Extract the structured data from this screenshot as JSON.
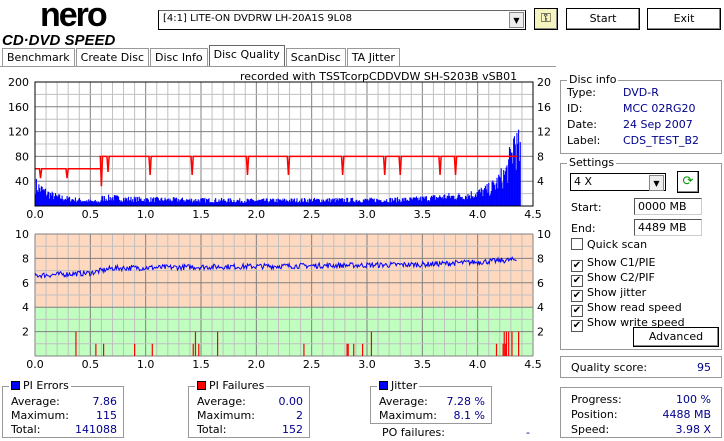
{
  "app": {
    "logo_top": "nero",
    "logo_bottom": "CD·DVD SPEED"
  },
  "toolbar": {
    "drive": "[4:1]  LITE-ON DVDRW LH-20A1S 9L08",
    "start": "Start",
    "exit": "Exit",
    "settings_icon": "keys-icon"
  },
  "tabs": [
    {
      "label": "Benchmark"
    },
    {
      "label": "Create Disc"
    },
    {
      "label": "Disc Info"
    },
    {
      "label": "Disc Quality",
      "active": true
    },
    {
      "label": "ScanDisc"
    },
    {
      "label": "TA Jitter"
    }
  ],
  "recorded_with": "recorded with TSSTcorpCDDVDW SH-S203B  vSB01",
  "disc_info": {
    "title": "Disc info",
    "type_label": "Type:",
    "type": "DVD-R",
    "id_label": "ID:",
    "id": "MCC 02RG20",
    "date_label": "Date:",
    "date": "24 Sep 2007",
    "label_label": "Label:",
    "label": "CDS_TEST_B2"
  },
  "settings": {
    "title": "Settings",
    "speed": "4 X",
    "start_label": "Start:",
    "start": "0000 MB",
    "end_label": "End:",
    "end": "4489 MB",
    "checks": [
      {
        "label": "Quick scan",
        "checked": false
      },
      {
        "label": "Show C1/PIE",
        "checked": true
      },
      {
        "label": "Show C2/PIF",
        "checked": true
      },
      {
        "label": "Show jitter",
        "checked": true
      },
      {
        "label": "Show read speed",
        "checked": true
      },
      {
        "label": "Show write speed",
        "checked": true
      }
    ],
    "advanced": "Advanced"
  },
  "quality": {
    "label": "Quality score:",
    "value": "95"
  },
  "progress": {
    "progress_label": "Progress:",
    "progress": "100 %",
    "position_label": "Position:",
    "position": "4488 MB",
    "speed_label": "Speed:",
    "speed": "3.98 X"
  },
  "pi_errors": {
    "title": "PI Errors",
    "color": "#0000ff",
    "average_label": "Average:",
    "average": "7.86",
    "maximum_label": "Maximum:",
    "maximum": "115",
    "total_label": "Total:",
    "total": "141088"
  },
  "pi_failures": {
    "title": "PI Failures",
    "color": "#ff0000",
    "average_label": "Average:",
    "average": "0.00",
    "maximum_label": "Maximum:",
    "maximum": "2",
    "total_label": "Total:",
    "total": "152"
  },
  "jitter": {
    "title": "Jitter",
    "color": "#0000ff",
    "average_label": "Average:",
    "average": "7.28 %",
    "maximum_label": "Maximum:",
    "maximum": "8.1 %",
    "po_label": "PO failures:",
    "po": "-"
  },
  "chart_data": [
    {
      "type": "bar",
      "xlim": [
        0,
        4.5
      ],
      "ylim": [
        0,
        200
      ],
      "y2lim": [
        0,
        20
      ],
      "grid": true,
      "xticks": [
        "0.0",
        "0.5",
        "1.0",
        "1.5",
        "2.0",
        "2.5",
        "3.0",
        "3.5",
        "4.0",
        "4.5"
      ],
      "yticks": [
        "40",
        "80",
        "120",
        "160",
        "200"
      ],
      "y2ticks": [
        "4",
        "8",
        "12",
        "16",
        "20"
      ],
      "pie": {
        "x": [
          0,
          0.05,
          0.1,
          0.15,
          0.2,
          0.3,
          0.4,
          0.5,
          0.58,
          0.6,
          0.7,
          0.8,
          1.0,
          1.5,
          2.0,
          2.5,
          3.0,
          3.4,
          3.6,
          3.7,
          3.8,
          3.9,
          4.0,
          4.1,
          4.15,
          4.2,
          4.25,
          4.3,
          4.33,
          4.35,
          4.38
        ],
        "y": [
          35,
          28,
          22,
          18,
          15,
          12,
          10,
          8,
          7,
          13,
          14,
          12,
          11,
          10,
          9,
          10,
          10,
          11,
          14,
          16,
          16,
          18,
          22,
          28,
          35,
          45,
          55,
          80,
          115,
          95,
          90
        ]
      },
      "read_speed": {
        "segments": [
          [
            0,
            0.6,
            6
          ],
          [
            0.6,
            4.36,
            8
          ]
        ],
        "dips": [
          [
            0.05,
            4.5
          ],
          [
            0.29,
            4.5
          ],
          [
            0.6,
            3.2
          ],
          [
            0.66,
            5.5
          ],
          [
            1.04,
            5
          ],
          [
            1.42,
            5
          ],
          [
            1.92,
            5
          ],
          [
            2.29,
            5
          ],
          [
            2.78,
            5
          ],
          [
            3.16,
            5
          ],
          [
            3.3,
            5
          ],
          [
            3.66,
            5
          ],
          [
            3.8,
            5
          ]
        ]
      }
    },
    {
      "type": "line",
      "xlim": [
        0,
        4.5
      ],
      "ylim": [
        0,
        10
      ],
      "grid": true,
      "xticks": [
        "0.0",
        "0.5",
        "1.0",
        "1.5",
        "2.0",
        "2.5",
        "3.0",
        "3.5",
        "4.0",
        "4.5"
      ],
      "yticks": [
        "2",
        "4",
        "6",
        "8",
        "10"
      ],
      "jitter": {
        "x": [
          0,
          0.5,
          0.6,
          0.7,
          1.5,
          2.5,
          3.5,
          4.0,
          4.35
        ],
        "y": [
          6.6,
          6.8,
          7.0,
          7.2,
          7.3,
          7.4,
          7.5,
          7.7,
          7.9
        ]
      },
      "pif": [
        [
          0.37,
          2
        ],
        [
          0.55,
          1
        ],
        [
          0.62,
          1
        ],
        [
          0.9,
          1
        ],
        [
          1.06,
          1
        ],
        [
          1.43,
          1
        ],
        [
          1.45,
          2
        ],
        [
          1.48,
          1
        ],
        [
          1.65,
          2
        ],
        [
          2.43,
          1
        ],
        [
          2.82,
          1
        ],
        [
          2.83,
          1
        ],
        [
          2.88,
          1
        ],
        [
          2.96,
          1
        ],
        [
          3.04,
          2
        ],
        [
          4.17,
          1
        ],
        [
          4.23,
          1
        ],
        [
          4.24,
          2
        ],
        [
          4.25,
          1
        ],
        [
          4.26,
          2
        ],
        [
          4.28,
          2
        ],
        [
          4.31,
          2
        ],
        [
          4.37,
          2
        ]
      ]
    }
  ]
}
